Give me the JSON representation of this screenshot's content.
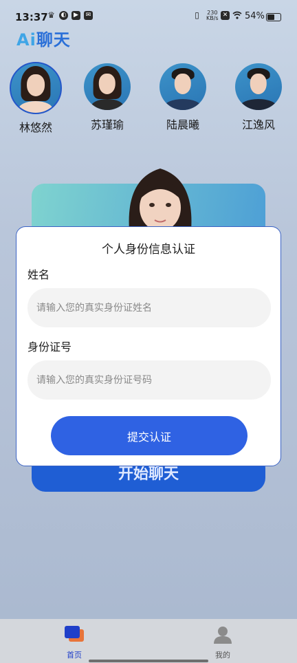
{
  "status_bar": {
    "time": "13:37",
    "net_speed_value": "230",
    "net_speed_unit": "KB/s",
    "battery_percent": "54%"
  },
  "app": {
    "logo_ai": "Ai",
    "logo_text": "聊天",
    "accent_color": "#2f62e3"
  },
  "characters": [
    {
      "name": "林悠然",
      "selected": true
    },
    {
      "name": "苏瑾瑜",
      "selected": false
    },
    {
      "name": "陆晨曦",
      "selected": false
    },
    {
      "name": "江逸风",
      "selected": false
    }
  ],
  "start_button": {
    "label": "开始聊天"
  },
  "auth_modal": {
    "title": "个人身份信息认证",
    "name_label": "姓名",
    "name_placeholder": "请输入您的真实身份证姓名",
    "id_label": "身份证号",
    "id_placeholder": "请输入您的真实身份证号码",
    "submit_label": "提交认证"
  },
  "tabbar": {
    "items": [
      {
        "label": "首页",
        "icon": "home-icon",
        "active": true
      },
      {
        "label": "我的",
        "icon": "user-icon",
        "active": false
      }
    ]
  }
}
